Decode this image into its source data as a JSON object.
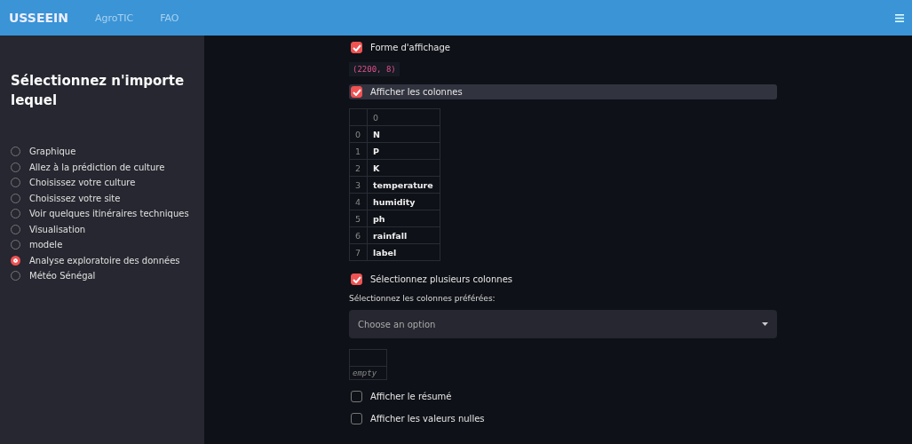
{
  "navbar": {
    "brand": "USSEEIN",
    "links": [
      "AgroTIC",
      "FAO"
    ]
  },
  "sidebar": {
    "title": "Sélectionnez n'importe lequel",
    "options": [
      {
        "label": "Graphique",
        "selected": false
      },
      {
        "label": "Allez à la prédiction de culture",
        "selected": false
      },
      {
        "label": "Choisissez votre culture",
        "selected": false
      },
      {
        "label": "Choisissez votre site",
        "selected": false
      },
      {
        "label": "Voir quelques itinéraires techniques",
        "selected": false
      },
      {
        "label": "Visualisation",
        "selected": false
      },
      {
        "label": "modele",
        "selected": false
      },
      {
        "label": "Analyse exploratoire des données",
        "selected": true
      },
      {
        "label": "Météo Sénégal",
        "selected": false
      }
    ]
  },
  "main": [
    {
      "kind": "checkbox",
      "label": "Forme d'affichage",
      "checked": true,
      "highlighted": false
    },
    {
      "kind": "code",
      "text": "(2200, 8)"
    },
    {
      "kind": "checkbox",
      "label": "Afficher les colonnes",
      "checked": true,
      "highlighted": true
    },
    {
      "kind": "table",
      "columns": [
        "",
        "0"
      ],
      "rows": [
        [
          "0",
          "N"
        ],
        [
          "1",
          "P"
        ],
        [
          "2",
          "K"
        ],
        [
          "3",
          "temperature"
        ],
        [
          "4",
          "humidity"
        ],
        [
          "5",
          "ph"
        ],
        [
          "6",
          "rainfall"
        ],
        [
          "7",
          "label"
        ]
      ]
    },
    {
      "kind": "checkbox",
      "label": "Sélectionnez plusieurs colonnes",
      "checked": true,
      "highlighted": false
    },
    {
      "kind": "label",
      "text": "Sélectionnez les colonnes préférées:"
    },
    {
      "kind": "select",
      "placeholder": "Choose an option"
    },
    {
      "kind": "empty_table",
      "text": "empty"
    },
    {
      "kind": "checkbox",
      "label": "Afficher le résumé",
      "checked": false,
      "highlighted": false
    },
    {
      "kind": "checkbox",
      "label": "Afficher les valeurs nulles",
      "checked": false,
      "highlighted": false
    }
  ]
}
